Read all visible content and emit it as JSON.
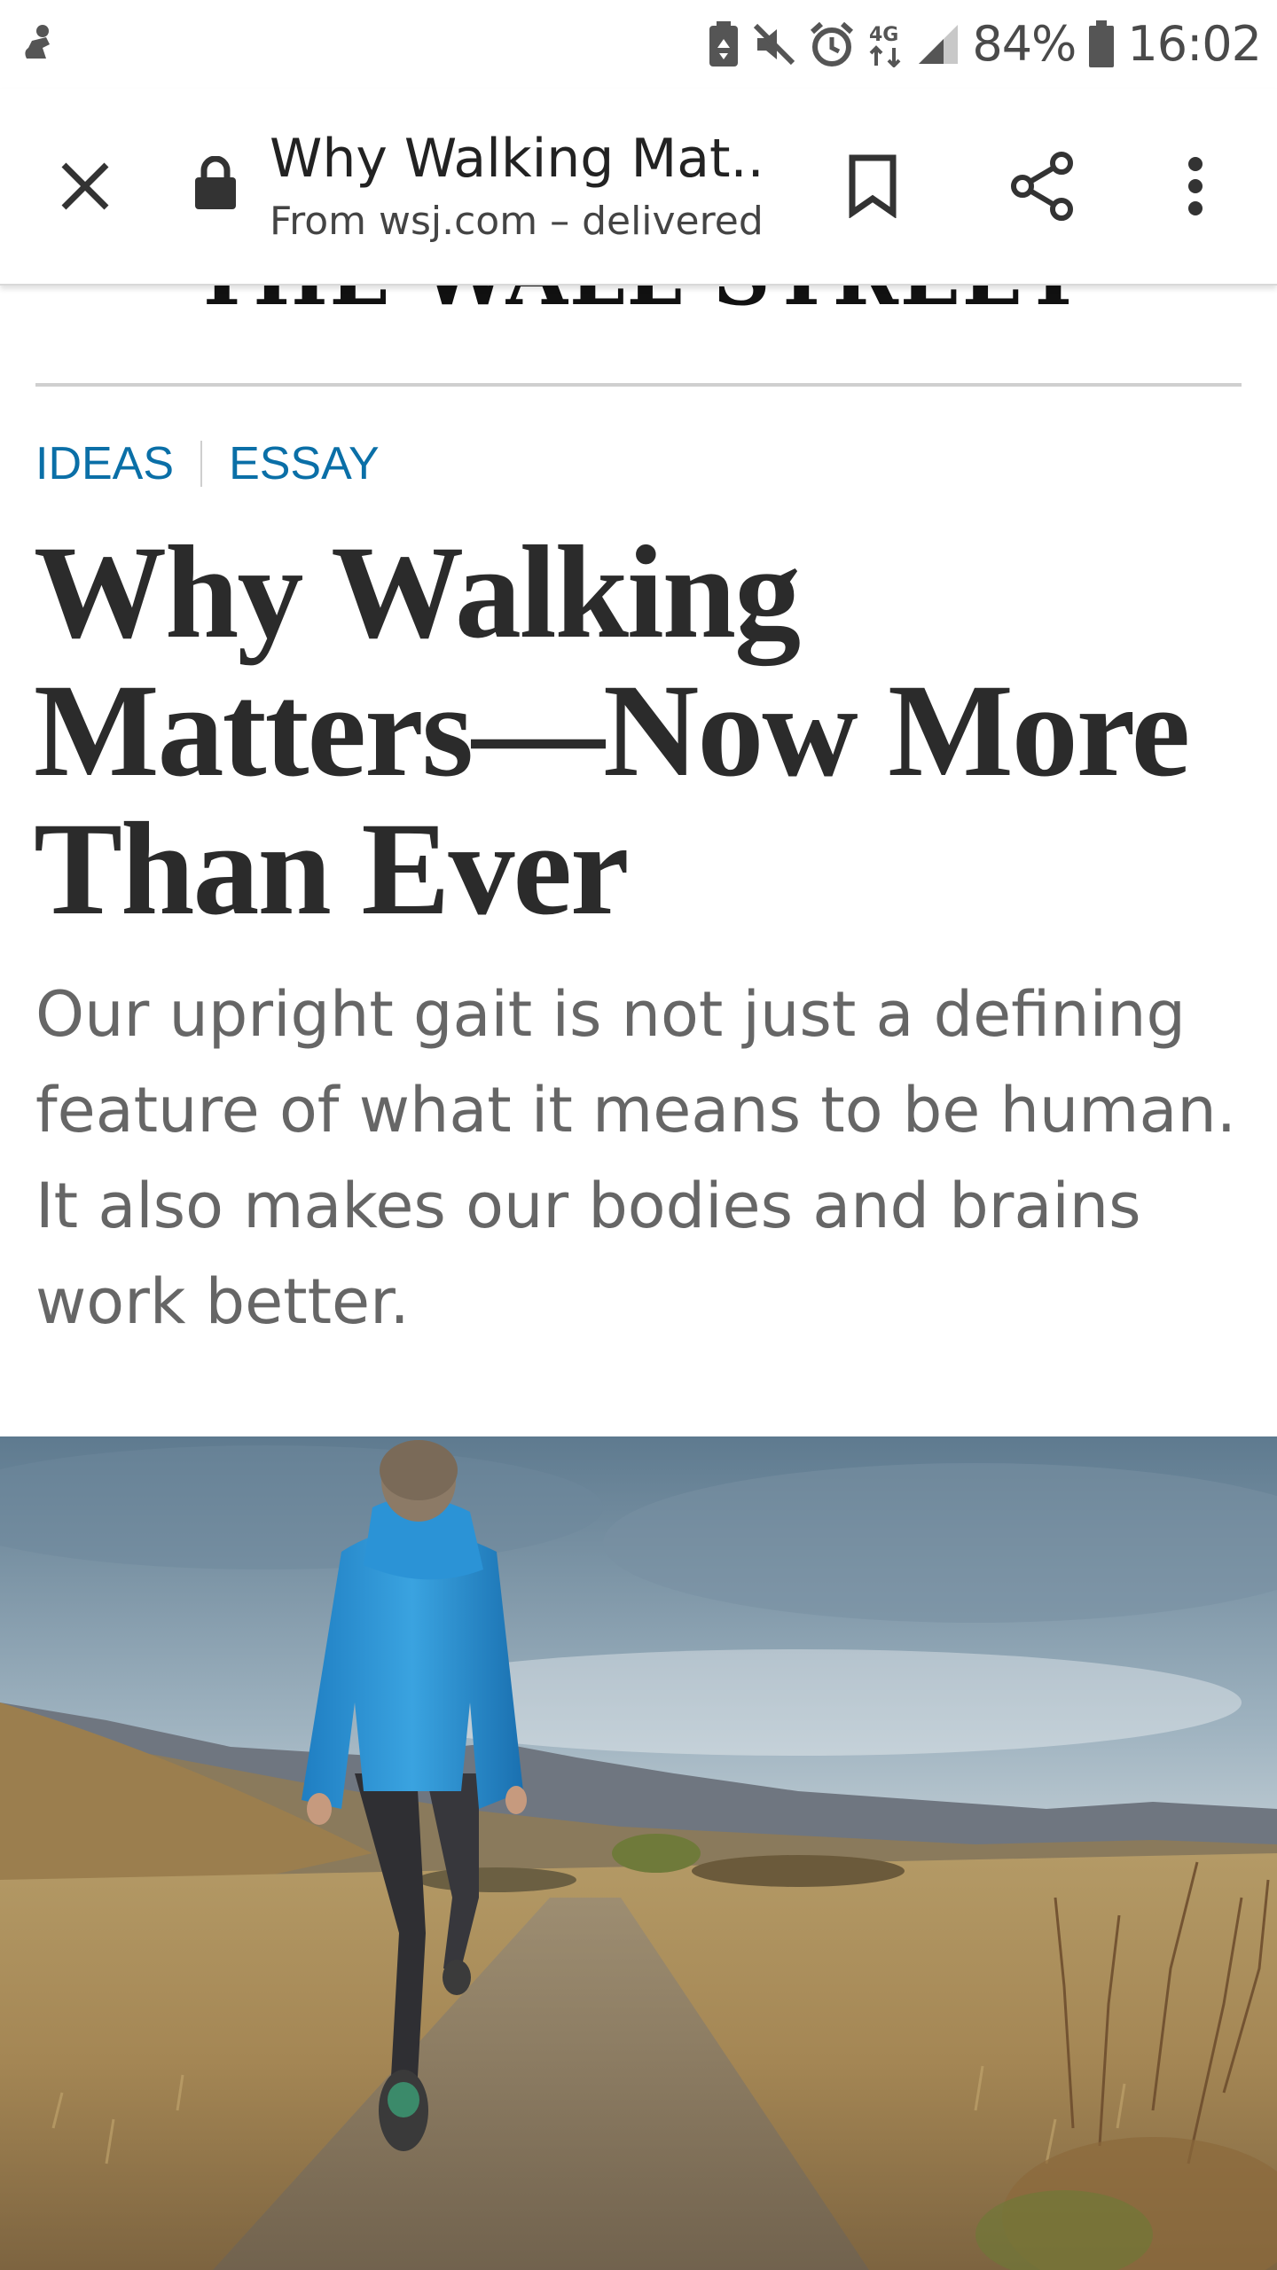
{
  "status_bar": {
    "battery_percent": "84%",
    "time": "16:02",
    "network": "4G",
    "icons": [
      "app-notification-icon",
      "battery-saver-icon",
      "mute-icon",
      "alarm-icon",
      "network-4g-icon",
      "signal-icon",
      "battery-icon"
    ]
  },
  "toolbar": {
    "title": "Why Walking Mat...",
    "subtitle": "From wsj.com – delivered",
    "icons": [
      "close-icon",
      "lock-icon",
      "bookmark-icon",
      "share-icon",
      "more-vert-icon"
    ]
  },
  "masthead": {
    "text": "THE WALL STREET JOURNAL."
  },
  "article": {
    "section": "IDEAS",
    "category": "ESSAY",
    "headline": "Why Walking Matters—Now More Than Ever",
    "dek": "Our upright gait is not just a defining feature of what it means to be human. It also makes our bodies and brains work better."
  },
  "colors": {
    "accent_link": "#0a6fa7",
    "headline": "#2b2b2b",
    "dek": "#666666",
    "jacket": "#2b8fd0"
  }
}
